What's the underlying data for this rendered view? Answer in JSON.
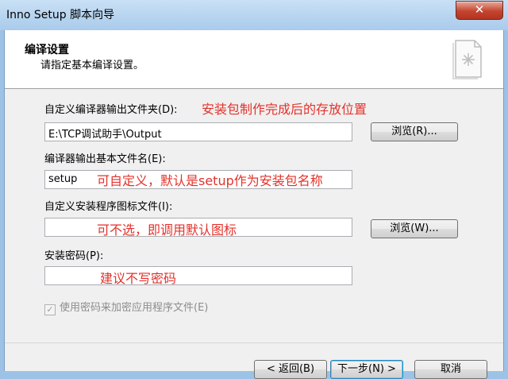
{
  "window": {
    "title": "Inno Setup 脚本向导",
    "close_glyph": "✕"
  },
  "header": {
    "title": "编译设置",
    "subtitle": "请指定基本编译设置。"
  },
  "fields": {
    "output_folder": {
      "label": "自定义编译器输出文件夹(D):",
      "value": "E:\\TCP调试助手\\Output",
      "browse_label": "浏览(R)...",
      "annotation": "安装包制作完成后的存放位置"
    },
    "base_filename": {
      "label": "编译器输出基本文件名(E):",
      "value": "setup",
      "annotation": "可自定义，默认是setup作为安装包名称"
    },
    "setup_icon": {
      "label": "自定义安装程序图标文件(I):",
      "value": "",
      "browse_label": "浏览(W)...",
      "annotation": "可不选，即调用默认图标"
    },
    "password": {
      "label": "安装密码(P):",
      "value": "",
      "annotation": "建议不写密码"
    },
    "encrypt": {
      "label": "使用密码来加密应用程序文件(E)",
      "checked": true
    }
  },
  "footer": {
    "back_label": "< 返回(B)",
    "next_label": "下一步(N) >",
    "cancel_label": "取消"
  },
  "colors": {
    "annotation": "#e3322b",
    "close": "#c4452f",
    "titlebar": "#a9cbeb"
  }
}
